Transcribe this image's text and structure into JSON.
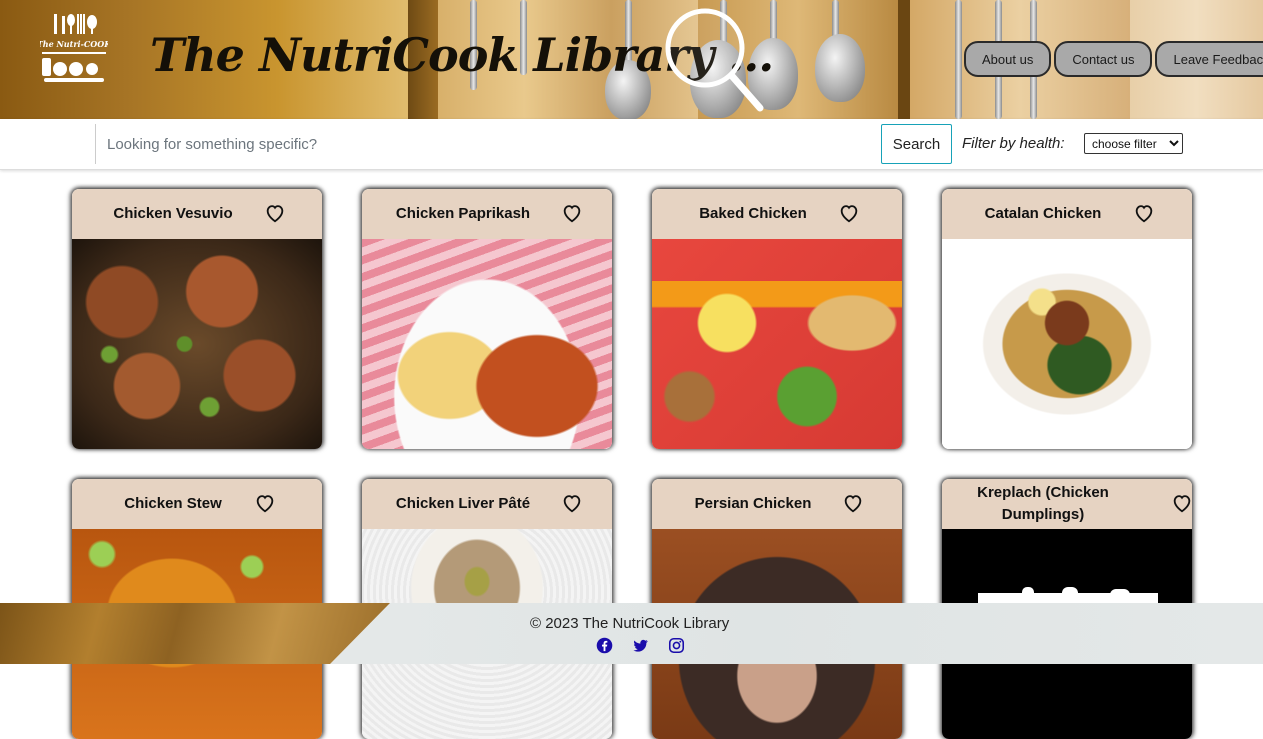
{
  "header": {
    "logo_text": "The Nutri-COOK",
    "title": "The NutriCook Library ...",
    "nav": [
      "About us",
      "Contact us",
      "Leave Feedback"
    ]
  },
  "search": {
    "placeholder": "Looking for something specific?",
    "button_label": "Search",
    "filter_label": "Filter by health:",
    "filter_selected": "choose filter"
  },
  "recipes": [
    {
      "title": "Chicken Vesuvio",
      "image": "roasted-chicken-with-peas"
    },
    {
      "title": "Chicken Paprikash",
      "image": "chicken-paprikash-with-spaetzle"
    },
    {
      "title": "Baked Chicken",
      "image": "baked-chicken-tray-meal"
    },
    {
      "title": "Catalan Chicken",
      "image": "catalan-chicken-bowl"
    },
    {
      "title": "Chicken Stew",
      "image": "chicken-stew-with-scallions"
    },
    {
      "title": "Chicken Liver Pâté",
      "image": "chicken-liver-pate-bowl"
    },
    {
      "title": "Persian Chicken",
      "image": "persian-chicken-plate"
    },
    {
      "title": "Kreplach (Chicken Dumplings)",
      "image": "tasting-logo-black"
    }
  ],
  "footer": {
    "copyright": "© 2023 The NutriCook Library",
    "socials": [
      "facebook-icon",
      "twitter-icon",
      "instagram-icon"
    ]
  },
  "colors": {
    "card_header": "#e6d3c2",
    "nav_button": "#a9a9a9",
    "search_border": "#17a2b8",
    "social_icons": "#1a0dab"
  }
}
